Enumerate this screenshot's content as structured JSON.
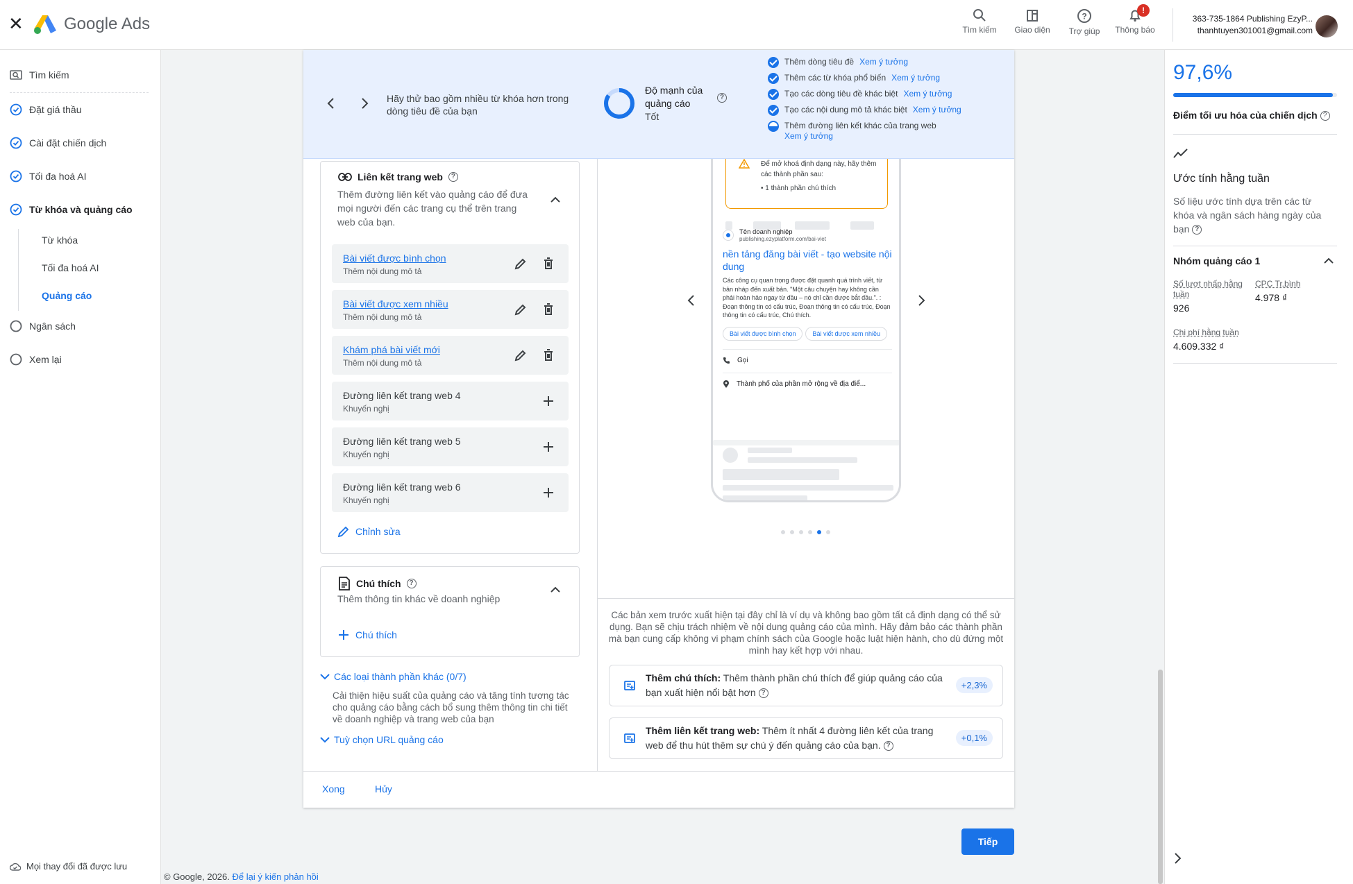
{
  "app": {
    "brand": "Google Ads",
    "colors": {
      "accent": "#1a73e8",
      "banner_bg": "#e8f0fe",
      "warning": "#f29900",
      "badge": "#d93025"
    }
  },
  "header": {
    "actions": [
      {
        "label": "Tìm kiếm",
        "icon": "search-icon"
      },
      {
        "label": "Giao diện",
        "icon": "appearance-icon"
      },
      {
        "label": "Trợ giúp",
        "icon": "help-icon"
      },
      {
        "label": "Thông báo",
        "icon": "bell-icon",
        "badge": "!"
      }
    ],
    "account": {
      "line1": "363-735-1864 Publishing EzyP...",
      "line2": "thanhtuyen301001@gmail.com"
    }
  },
  "sidebar": {
    "search": "Tìm kiếm",
    "items": [
      {
        "label": "Đặt giá thầu",
        "state": "done"
      },
      {
        "label": "Cài đặt chiến dịch",
        "state": "done"
      },
      {
        "label": "Tối đa hoá AI",
        "state": "done"
      },
      {
        "label": "Từ khóa và quảng cáo",
        "state": "done-active"
      },
      {
        "label": "Ngân sách",
        "state": "todo"
      },
      {
        "label": "Xem lại",
        "state": "todo"
      }
    ],
    "sub_items": [
      "Từ khóa",
      "Tối đa hoá AI",
      "Quảng cáo"
    ],
    "saved": "Mọi thay đổi đã được lưu"
  },
  "banner": {
    "tip": "Hãy thử bao gồm nhiều từ khóa hơn trong dòng tiêu đề của bạn",
    "strength_label": "Độ mạnh của quảng cáo",
    "strength_value": "Tốt",
    "strength_level": 0.85,
    "checklist": [
      {
        "text": "Thêm dòng tiêu đề",
        "link": "Xem ý tưởng",
        "done": true
      },
      {
        "text": "Thêm các từ khóa phổ biến",
        "link": "Xem ý tưởng",
        "done": true
      },
      {
        "text": "Tạo các dòng tiêu đề khác biệt",
        "link": "Xem ý tưởng",
        "done": true
      },
      {
        "text": "Tạo các nội dung mô tả khác biệt",
        "link": "Xem ý tưởng",
        "done": true
      },
      {
        "text": "Thêm đường liên kết khác của trang web",
        "link": "Xem ý tưởng",
        "done": false
      }
    ]
  },
  "sitelinks": {
    "title": "Liên kết trang web",
    "desc": "Thêm đường liên kết vào quảng cáo để đưa mọi người đến các trang cụ thể trên trang web của bạn.",
    "rows": [
      {
        "title": "Bài viết được bình chọn",
        "sub": "Thêm nội dung mô tả",
        "filled": true
      },
      {
        "title": "Bài viết được xem nhiều",
        "sub": "Thêm nội dung mô tả",
        "filled": true
      },
      {
        "title": "Khám phá bài viết mới",
        "sub": "Thêm nội dung mô tả",
        "filled": true
      },
      {
        "title": "Đường liên kết trang web 4",
        "sub": "Khuyến nghị",
        "filled": false
      },
      {
        "title": "Đường liên kết trang web 5",
        "sub": "Khuyến nghị",
        "filled": false
      },
      {
        "title": "Đường liên kết trang web 6",
        "sub": "Khuyến nghị",
        "filled": false
      }
    ],
    "edit": "Chỉnh sửa"
  },
  "callouts": {
    "title": "Chú thích",
    "desc": "Thêm thông tin khác về doanh nghiệp",
    "add": "Chú thích"
  },
  "other_assets": {
    "title": "Các loại thành phần khác (0/7)",
    "desc": "Cải thiện hiệu suất của quảng cáo và tăng tính tương tác cho quảng cáo bằng cách bổ sung thêm thông tin chi tiết về doanh nghiệp và trang web của bạn",
    "url_options": "Tuỳ chọn URL quảng cáo"
  },
  "preview": {
    "warning_text": "Để mở khoá định dạng này, hãy thêm các thành phần sau:",
    "warning_item": "1 thành phần chú thích",
    "business_name": "Tên doanh nghiệp",
    "display_url": "publishing.ezyplatform.com/bai-viet",
    "headline": "nền tảng đăng bài viết - tạo website nội dung",
    "description": "Các công cụ quan trọng được đặt quanh quá trình viết, từ bản nháp đến xuất bản. \"Một câu chuyện hay không cần phải hoàn hảo ngay từ đầu – nó chỉ cần được bắt đầu.\". : Đoạn thông tin có cấu trúc, Đoạn thông tin có cấu trúc, Đoạn thông tin có cấu trúc, Chú thích.",
    "chips": [
      "Bài viết được bình chọn",
      "Bài viết được xem nhiều"
    ],
    "call": "Gọi",
    "location": "Thành phố của phần mở rộng về địa điể...",
    "page_count": 6,
    "active_page": 5,
    "disclaimer": "Các bản xem trước xuất hiện tại đây chỉ là ví dụ và không bao gồm tất cả định dạng có thể sử dụng. Bạn sẽ chịu trách nhiệm về nội dung quảng cáo của mình. Hãy đảm bảo các thành phần mà bạn cung cấp không vi phạm chính sách của Google hoặc luật hiện hành, cho dù đứng một mình hay kết hợp với nhau."
  },
  "suggestions": [
    {
      "bold": "Thêm chú thích:",
      "text": " Thêm thành phần chú thích để giúp quảng cáo của bạn xuất hiện nổi bật hơn",
      "delta": "+2,3%"
    },
    {
      "bold": "Thêm liên kết trang web:",
      "text": " Thêm ít nhất 4 đường liên kết của trang web để thu hút thêm sự chú ý đến quảng cáo của bạn.",
      "delta": "+0,1%"
    }
  ],
  "footer": {
    "done": "Xong",
    "cancel": "Hủy",
    "next": "Tiếp",
    "copyright": "© Google, 2026.",
    "feedback": "Để lại ý kiến phản hồi"
  },
  "right_panel": {
    "score": "97,6%",
    "score_value": 97.6,
    "score_label": "Điểm tối ưu hóa của chiến dịch",
    "weekly_title": "Ước tính hằng tuần",
    "weekly_desc": "Số liệu ước tính dựa trên các từ khóa và ngân sách hàng ngày của bạn",
    "group_title": "Nhóm quảng cáo 1",
    "metrics": [
      {
        "label": "Số lượt nhấp hằng tuần",
        "value": "926"
      },
      {
        "label": "CPC Tr.bình",
        "value": "4.978 ₫"
      },
      {
        "label": "Chi phí hằng tuần",
        "value": "4.609.332 ₫"
      }
    ]
  }
}
